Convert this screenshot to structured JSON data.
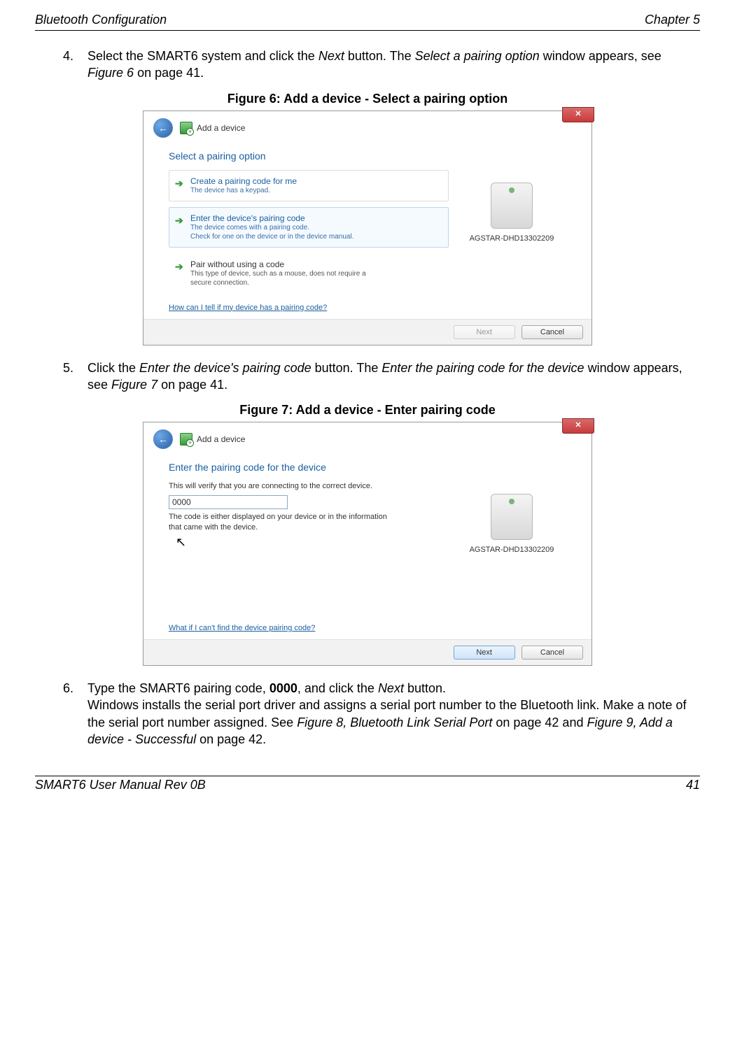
{
  "header": {
    "left": "Bluetooth Configuration",
    "right": "Chapter 5"
  },
  "footer": {
    "left": "SMART6 User Manual Rev 0B",
    "right": "41"
  },
  "steps": {
    "s4": {
      "num": "4.",
      "text_a": "Select the SMART6 system and click the ",
      "next": "Next",
      "text_b": " button. The ",
      "select_opt": "Select a pairing option",
      "text_c": " window appears, see ",
      "fig6_ref": "Figure 6",
      "text_d": " on page 41."
    },
    "s5": {
      "num": "5.",
      "text_a": "Click the ",
      "enter_code": "Enter the device's pairing code",
      "text_b": " button. The ",
      "enter_for": "Enter the pairing code for the device",
      "text_c": " window appears, see ",
      "fig7_ref": "Figure 7",
      "text_d": " on page 41."
    },
    "s6": {
      "num": "6.",
      "text_a": "Type the SMART6 pairing code, ",
      "code_bold": "0000",
      "text_b": ", and click the ",
      "next": "Next",
      "text_c": " button.",
      "line2_a": "Windows installs the serial port driver and assigns a serial port number to the Bluetooth link. Make a note of the serial port number assigned. See ",
      "fig8_ref": "Figure 8, Bluetooth Link Serial Port",
      "line2_b": " on page 42 and ",
      "fig9_ref": "Figure 9, Add a device - Successful",
      "line2_c": " on page 42."
    }
  },
  "fig6": {
    "caption": "Figure 6: Add a device - Select a pairing option",
    "window_title": "Add a device",
    "heading": "Select a pairing option",
    "device_name": "AGSTAR-DHD13302209",
    "opt1": {
      "title": "Create a pairing code for me",
      "sub": "The device has a keypad."
    },
    "opt2": {
      "title": "Enter the device's pairing code",
      "sub1": "The device comes with a pairing code.",
      "sub2": "Check for one on the device or in the device manual."
    },
    "opt3": {
      "title": "Pair without using a code",
      "sub1": "This type of device, such as a mouse, does not require a",
      "sub2": "secure connection."
    },
    "help": "How can I tell if my device has a pairing code?",
    "btn_next": "Next",
    "btn_cancel": "Cancel"
  },
  "fig7": {
    "caption": "Figure 7: Add a device - Enter pairing code",
    "window_title": "Add a device",
    "heading": "Enter the pairing code for the device",
    "verify": "This will verify that you are connecting to the correct device.",
    "code_value": "0000",
    "code_note": "The code is either displayed on your device or in the information that came with the device.",
    "device_name": "AGSTAR-DHD13302209",
    "help": "What if I can't find the device pairing code?",
    "btn_next": "Next",
    "btn_cancel": "Cancel"
  }
}
